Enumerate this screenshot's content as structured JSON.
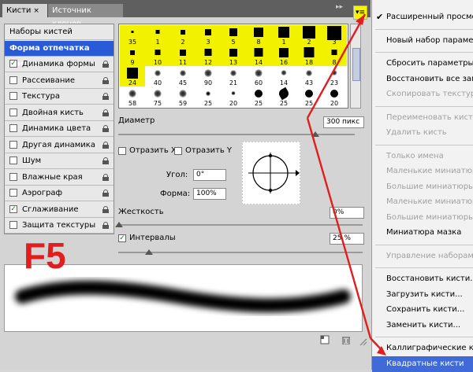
{
  "tabs": {
    "active": "Кисти",
    "close": "×",
    "inactive": "Источник клонов"
  },
  "header": {
    "collapse": "▸▸",
    "menu_icon": "▾≡"
  },
  "left_list": [
    {
      "label": "Наборы кистей",
      "type": "header"
    },
    {
      "label": "Форма отпечатка кисти",
      "type": "selected"
    },
    {
      "label": "Динамика формы",
      "checked": true,
      "lock": true
    },
    {
      "label": "Рассеивание",
      "checked": false,
      "lock": true
    },
    {
      "label": "Текстура",
      "checked": false,
      "lock": true
    },
    {
      "label": "Двойная кисть",
      "checked": false,
      "lock": true
    },
    {
      "label": "Динамика цвета",
      "checked": false,
      "lock": true
    },
    {
      "label": "Другая динамика",
      "checked": false,
      "lock": true
    },
    {
      "label": "Шум",
      "checked": false,
      "lock": true
    },
    {
      "label": "Влажные края",
      "checked": false,
      "lock": true
    },
    {
      "label": "Аэрограф",
      "checked": false,
      "lock": true
    },
    {
      "label": "Сглаживание",
      "checked": true,
      "lock": true
    },
    {
      "label": "Защита текстуры",
      "checked": false,
      "lock": true
    }
  ],
  "brushes": {
    "row0": [
      "35",
      "1",
      "2",
      "3",
      "5",
      "8",
      "1",
      "2",
      "3"
    ],
    "row1": [
      "9",
      "10",
      "11",
      "12",
      "13",
      "14",
      "16",
      "18",
      "8"
    ],
    "row2": [
      "24",
      "40",
      "45",
      "90",
      "21",
      "60",
      "14",
      "43",
      "23"
    ],
    "row3": [
      "58",
      "75",
      "59",
      "25",
      "20",
      "25",
      "25",
      "25",
      "20"
    ]
  },
  "controls": {
    "diameter_label": "Диаметр",
    "diameter_value": "300 пикс",
    "flip_x": "Отразить X",
    "flip_y": "Отразить Y",
    "angle_label": "Угол:",
    "angle_value": "0°",
    "roundness_label": "Форма:",
    "roundness_value": "100%",
    "hardness_label": "Жесткость",
    "hardness_value": "0%",
    "spacing_label": "Интервалы",
    "spacing_checked": true,
    "spacing_value": "25 %"
  },
  "overlay_key": "F5",
  "menu": {
    "items": [
      {
        "label": "Расширенный просмотр",
        "checked": true,
        "disabled": false
      },
      {
        "sep": true
      },
      {
        "label": "Новый набор параметров",
        "disabled": false
      },
      {
        "sep": true
      },
      {
        "label": "Сбросить параметры",
        "disabled": false
      },
      {
        "label": "Восстановить все замки",
        "disabled": false
      },
      {
        "label": "Скопировать текстуру",
        "disabled": true
      },
      {
        "sep": true
      },
      {
        "label": "Переименовать кисть",
        "disabled": true
      },
      {
        "label": "Удалить кисть",
        "disabled": true
      },
      {
        "sep": true
      },
      {
        "label": "Только имена",
        "disabled": true
      },
      {
        "label": "Маленькие миниатюры",
        "disabled": true
      },
      {
        "label": "Большие миниатюры",
        "disabled": true
      },
      {
        "label": "Маленькие миниатюры",
        "disabled": true
      },
      {
        "label": "Большие миниатюры",
        "disabled": true
      },
      {
        "label": "Миниатюра мазка",
        "disabled": false
      },
      {
        "sep": true
      },
      {
        "label": "Управление наборами",
        "disabled": true
      },
      {
        "sep": true
      },
      {
        "label": "Восстановить кисти...",
        "disabled": false
      },
      {
        "label": "Загрузить кисти...",
        "disabled": false
      },
      {
        "label": "Сохранить кисти...",
        "disabled": false
      },
      {
        "label": "Заменить кисти...",
        "disabled": false
      },
      {
        "sep": true
      },
      {
        "label": "Каллиграфические кисти",
        "disabled": false
      },
      {
        "label": "Квадратные кисти",
        "disabled": false,
        "highlight": true
      }
    ]
  },
  "colors": {
    "accent": "#3f6ad8",
    "highlight_yellow": "#f2f200",
    "annotation_red": "#e01e1e"
  }
}
